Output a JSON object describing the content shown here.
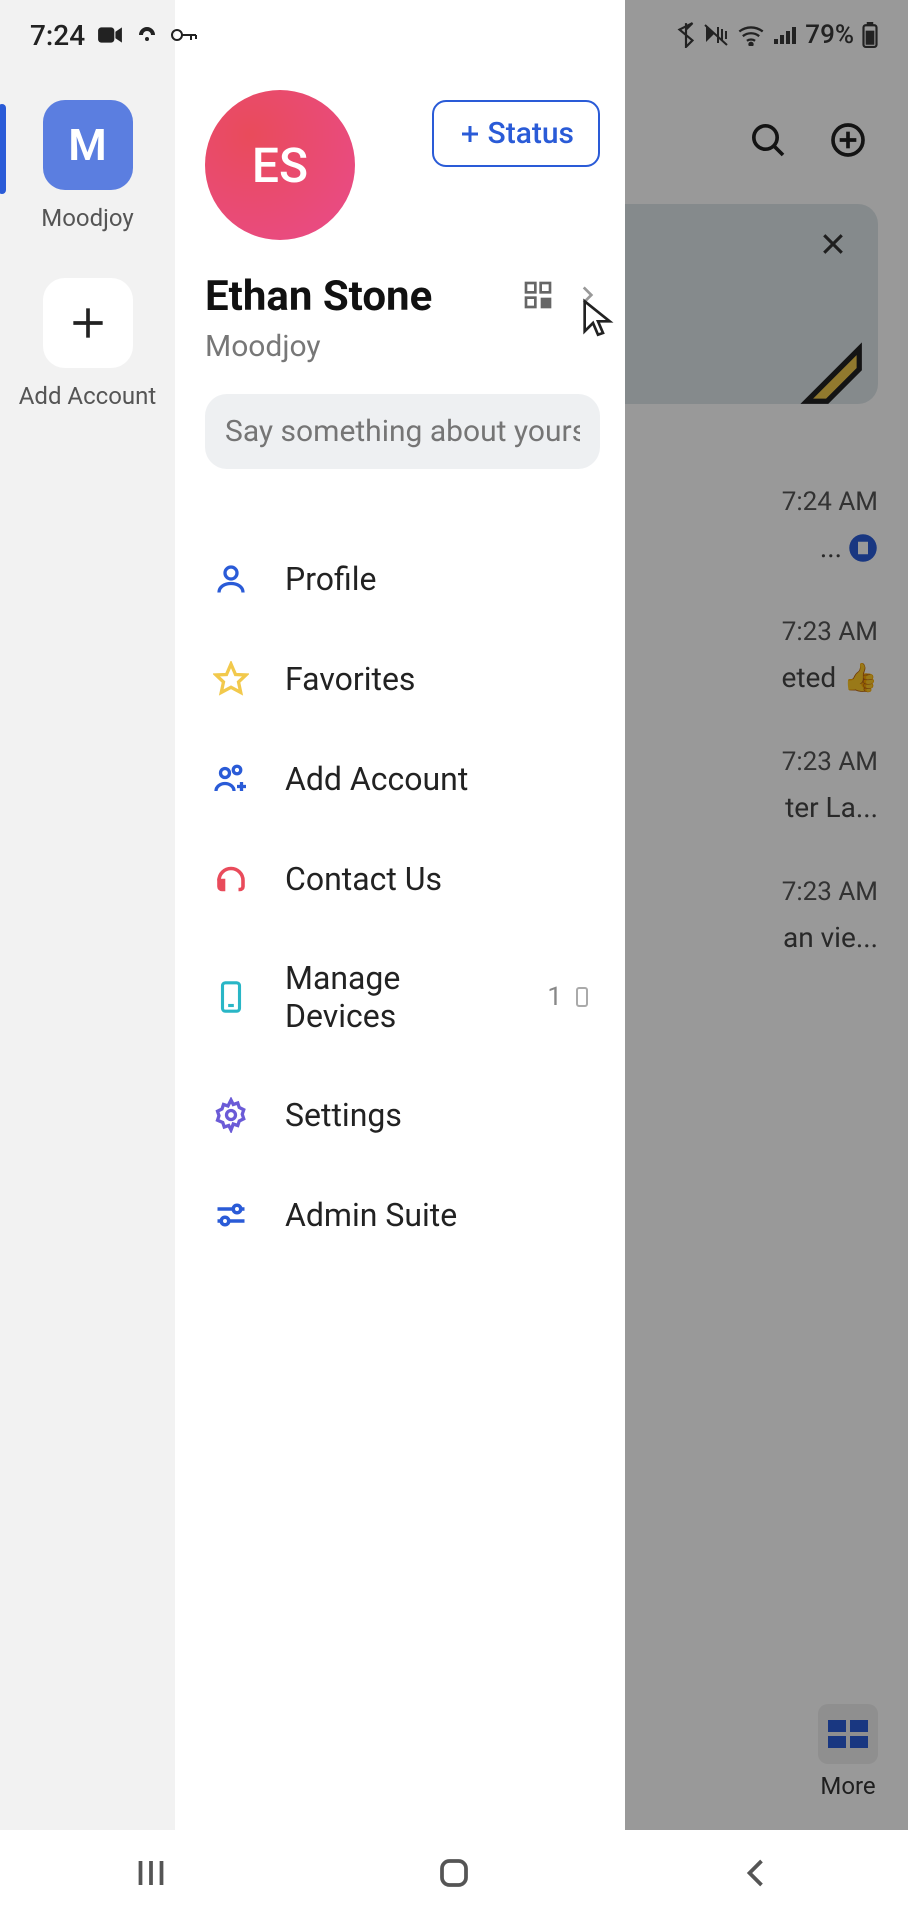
{
  "status_bar": {
    "time": "7:24",
    "battery": "79%"
  },
  "accounts": {
    "primary_letter": "M",
    "primary_label": "Moodjoy",
    "add_label": "Add Account"
  },
  "profile": {
    "initials": "ES",
    "name": "Ethan Stone",
    "org": "Moodjoy",
    "status_button": "Status",
    "bio_placeholder": "Say something about yourself..."
  },
  "menu": {
    "profile": "Profile",
    "favorites": "Favorites",
    "add_account": "Add Account",
    "contact_us": "Contact Us",
    "manage_devices": "Manage Devices",
    "device_count": "1",
    "settings": "Settings",
    "admin_suite": "Admin Suite"
  },
  "background": {
    "rows": [
      {
        "time": "7:24 AM",
        "excerpt": "..."
      },
      {
        "time": "7:23 AM",
        "excerpt": "eted 👍"
      },
      {
        "time": "7:23 AM",
        "excerpt": "ter La..."
      },
      {
        "time": "7:23 AM",
        "excerpt": "an vie..."
      }
    ],
    "more_label": "More"
  }
}
